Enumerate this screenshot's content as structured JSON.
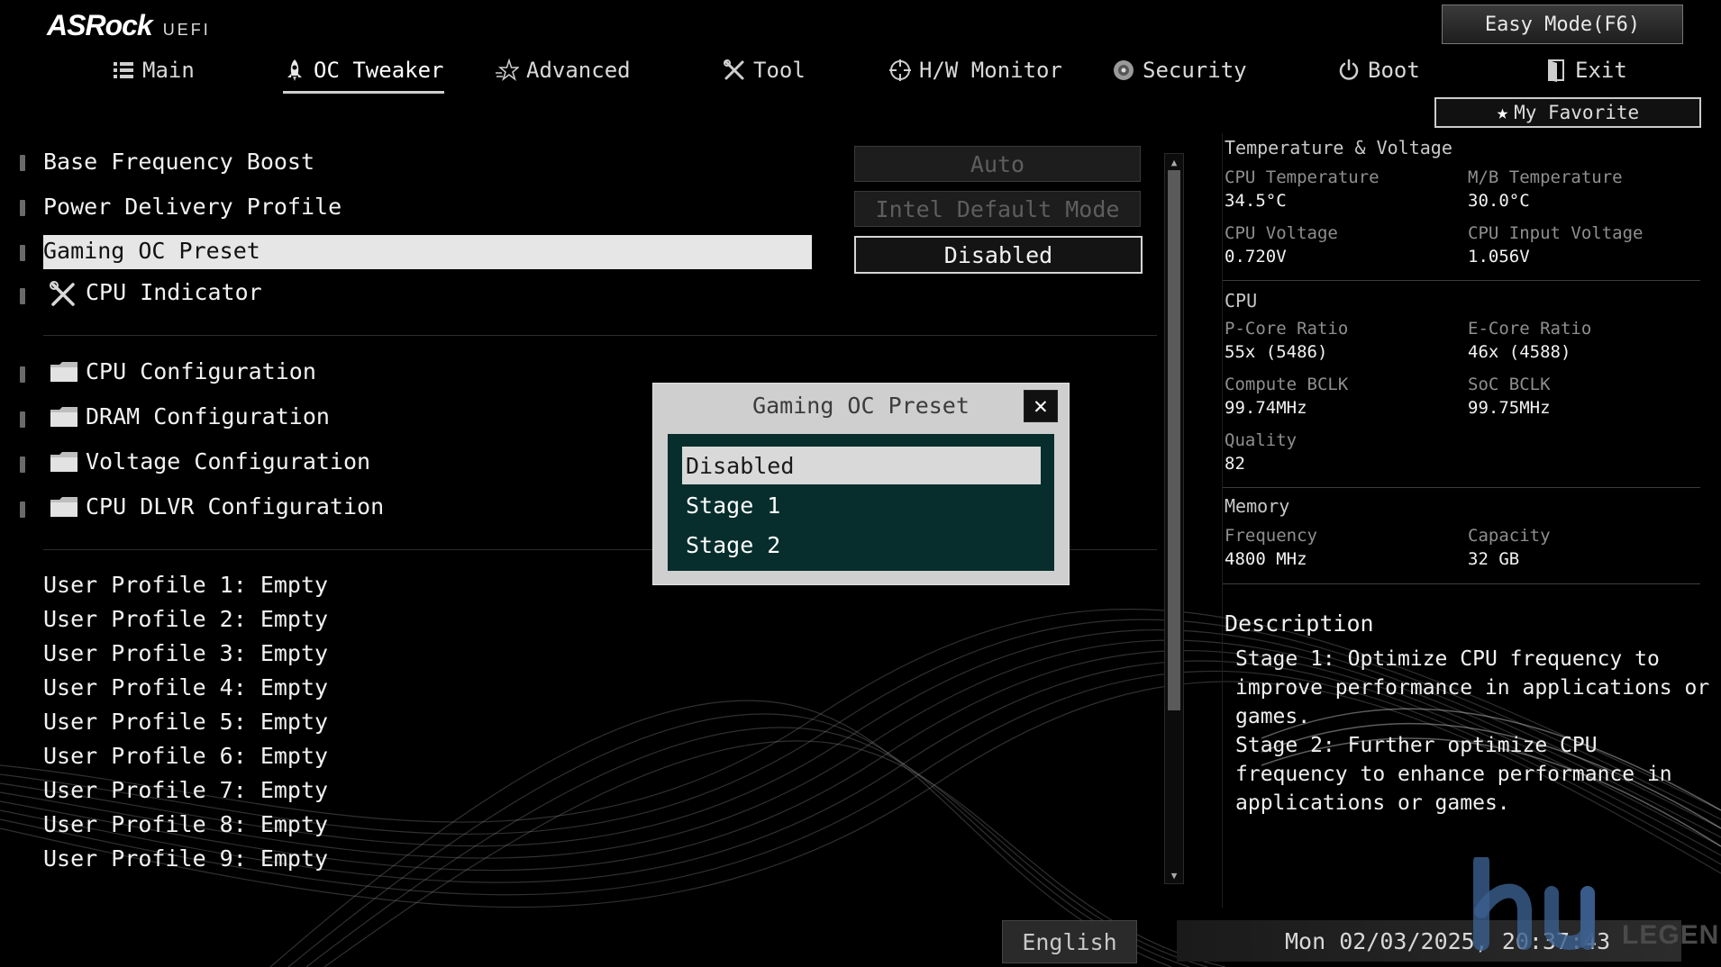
{
  "header": {
    "brand": "ASRock",
    "brand_suffix": "UEFI",
    "easy_mode_label": "Easy Mode(F6)",
    "my_favorite_label": "My Favorite"
  },
  "tabs": [
    {
      "label": "Main",
      "icon": "list-icon"
    },
    {
      "label": "OC Tweaker",
      "icon": "rocket-icon",
      "active": true
    },
    {
      "label": "Advanced",
      "icon": "star-icon"
    },
    {
      "label": "Tool",
      "icon": "wrench-icon"
    },
    {
      "label": "H/W Monitor",
      "icon": "crosshair-icon"
    },
    {
      "label": "Security",
      "icon": "shield-icon"
    },
    {
      "label": "Boot",
      "icon": "power-icon"
    },
    {
      "label": "Exit",
      "icon": "exit-door-icon"
    }
  ],
  "settings": [
    {
      "label": "Base Frequency Boost",
      "value": "Auto"
    },
    {
      "label": "Power Delivery Profile",
      "value": "Intel Default Mode"
    },
    {
      "label": "Gaming OC Preset",
      "value": "Disabled",
      "selected": true
    },
    {
      "label": "CPU Indicator",
      "icon": "tools-icon"
    }
  ],
  "submenus": [
    {
      "label": "CPU Configuration"
    },
    {
      "label": "DRAM Configuration"
    },
    {
      "label": "Voltage Configuration"
    },
    {
      "label": "CPU DLVR Configuration"
    }
  ],
  "profiles": [
    "User Profile 1: Empty",
    "User Profile 2: Empty",
    "User Profile 3: Empty",
    "User Profile 4: Empty",
    "User Profile 5: Empty",
    "User Profile 6: Empty",
    "User Profile 7: Empty",
    "User Profile 8: Empty",
    "User Profile 9: Empty"
  ],
  "popup": {
    "title": "Gaming OC Preset",
    "options": [
      "Disabled",
      "Stage 1",
      "Stage 2"
    ],
    "selected_index": 0
  },
  "monitor": {
    "temp_voltage_title": "Temperature & Voltage",
    "cpu_temp_label": "CPU Temperature",
    "cpu_temp_value": "34.5°C",
    "mb_temp_label": "M/B Temperature",
    "mb_temp_value": "30.0°C",
    "cpu_voltage_label": "CPU Voltage",
    "cpu_voltage_value": "0.720V",
    "cpu_input_voltage_label": "CPU Input Voltage",
    "cpu_input_voltage_value": "1.056V",
    "cpu_title": "CPU",
    "pcore_label": "P-Core Ratio",
    "pcore_value": "55x (5486)",
    "ecore_label": "E-Core Ratio",
    "ecore_value": "46x (4588)",
    "compute_bclk_label": "Compute BCLK",
    "compute_bclk_value": "99.74MHz",
    "soc_bclk_label": "SoC BCLK",
    "soc_bclk_value": "99.75MHz",
    "quality_label": "Quality",
    "quality_value": "82",
    "memory_title": "Memory",
    "freq_label": "Frequency",
    "freq_value": "4800 MHz",
    "capacity_label": "Capacity",
    "capacity_value": "32 GB"
  },
  "description": {
    "title": "Description",
    "text": "Stage 1: Optimize CPU frequency to\nimprove performance in applications or\ngames.\nStage 2: Further optimize CPU\nfrequency to enhance performance in\napplications or games."
  },
  "footer": {
    "language": "English",
    "datetime": "Mon 02/03/2025, 20:37:43"
  },
  "watermark": {
    "text": "LEGEND"
  }
}
